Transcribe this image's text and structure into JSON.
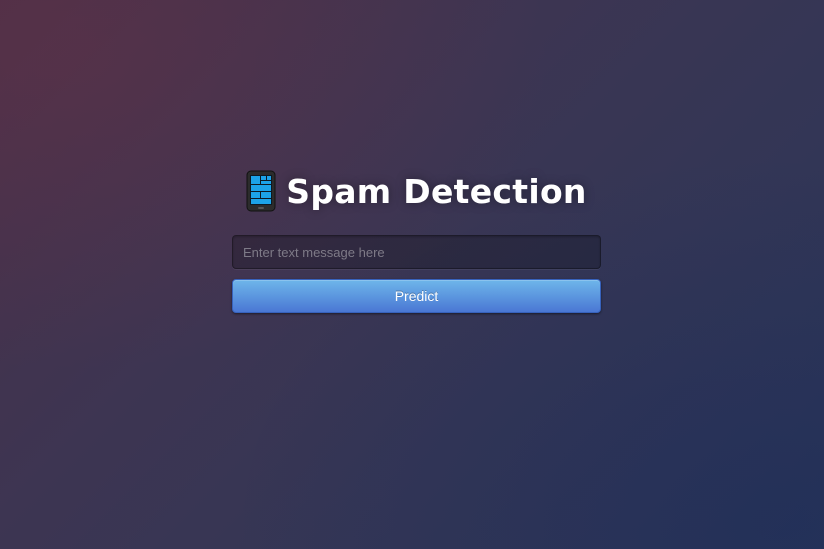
{
  "page": {
    "title": "Spam Detection",
    "title_icon": "mobile-phone-icon"
  },
  "form": {
    "message_input": {
      "value": "",
      "placeholder": "Enter text message here"
    },
    "predict_label": "Predict"
  },
  "colors": {
    "background_top_left": "#4a3048",
    "background_bottom_right": "#2a3558",
    "button_top": "#6eb6ea",
    "button_bottom": "#4a77d4",
    "phone_screen": "#1ca3e8"
  }
}
